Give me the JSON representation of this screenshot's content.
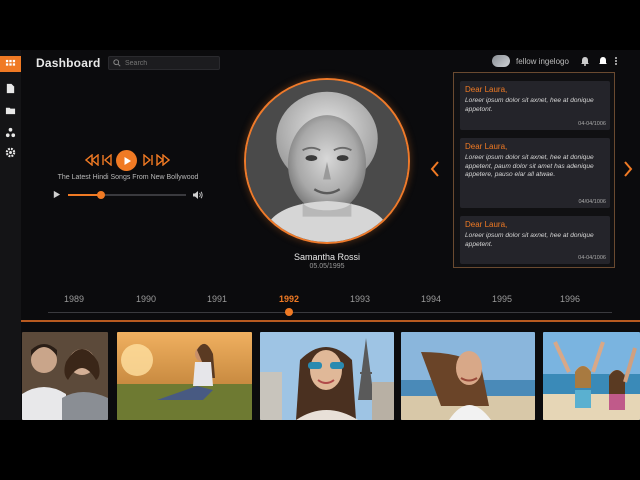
{
  "header": {
    "title": "Dashboard",
    "search_placeholder": "Search",
    "user_name": "fellow ingelogo"
  },
  "sidebar": {
    "items": [
      {
        "icon": "grid-icon",
        "active": true
      },
      {
        "icon": "document-icon",
        "active": false
      },
      {
        "icon": "folder-icon",
        "active": false
      },
      {
        "icon": "network-icon",
        "active": false
      },
      {
        "icon": "gear-icon",
        "active": false
      }
    ]
  },
  "player": {
    "song_title": "The Latest Hindi Songs From New Bollywood",
    "progress": 0.28
  },
  "profile": {
    "name": "Samantha Rossi",
    "date": "05.05/1995"
  },
  "messages": [
    {
      "to": "Dear Laura,",
      "body": "Loreer ipsum dolor sit axnet, hee at donique appetont.",
      "date": "04-04/1006"
    },
    {
      "to": "Dear Laura,",
      "body": "Loreer ipsum dolor sit axnet, hee at donique appetent, paum dolor sit amet has adenique appetere, pauso elar all atwae.",
      "date": "04/04/1006"
    },
    {
      "to": "Dear Laura,",
      "body": "Loreer ipsum dolor sit axnet, hee at donique appetent.",
      "date": "04-04/1006"
    }
  ],
  "timeline": {
    "years": [
      "1989",
      "1990",
      "1991",
      "1992",
      "1993",
      "1994",
      "1995",
      "1996"
    ],
    "selected": "1992"
  },
  "gallery": {
    "photos": [
      "couple-portrait",
      "woman-sitting-field",
      "woman-sunglasses-eiffel",
      "woman-beach-wind",
      "women-beach-arms-up"
    ]
  },
  "colors": {
    "accent": "#f07a24",
    "background": "#0b0b0d",
    "card": "#24242a"
  }
}
